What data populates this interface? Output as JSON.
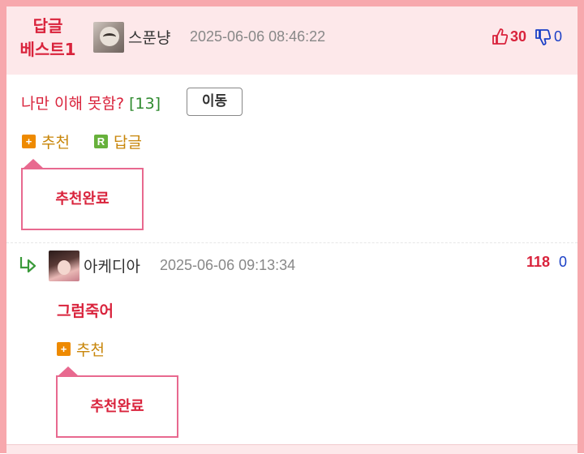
{
  "best_comment": {
    "badge_line1": "답글",
    "badge_line2": "베스트1",
    "author": "스푼냥",
    "timestamp": "2025-06-06 08:46:22",
    "upvotes": "30",
    "downvotes": "0",
    "text": "나만 이해 못함?",
    "reply_count": "[13]",
    "move_button": "이동",
    "recommend_label": "추천",
    "reply_label": "답글",
    "recommend_done": "추천완료"
  },
  "reply": {
    "author": "아케디아",
    "timestamp": "2025-06-06 09:13:34",
    "upvotes": "118",
    "downvotes": "0",
    "text": "그럼죽어",
    "recommend_label": "추천",
    "recommend_done": "추천완료"
  },
  "icons": {
    "plus": "+",
    "reply_letter": "R",
    "thumb_up": "thumbs-up-icon",
    "thumb_down": "thumbs-down-icon",
    "reply_arrow": "reply-arrow-icon"
  },
  "colors": {
    "accent_red": "#d9233c",
    "down_blue": "#1a3fc6",
    "header_bg": "#fde8ea",
    "border_pink": "#f7a8ad",
    "orange": "#ee8a00",
    "green": "#67b13b"
  }
}
